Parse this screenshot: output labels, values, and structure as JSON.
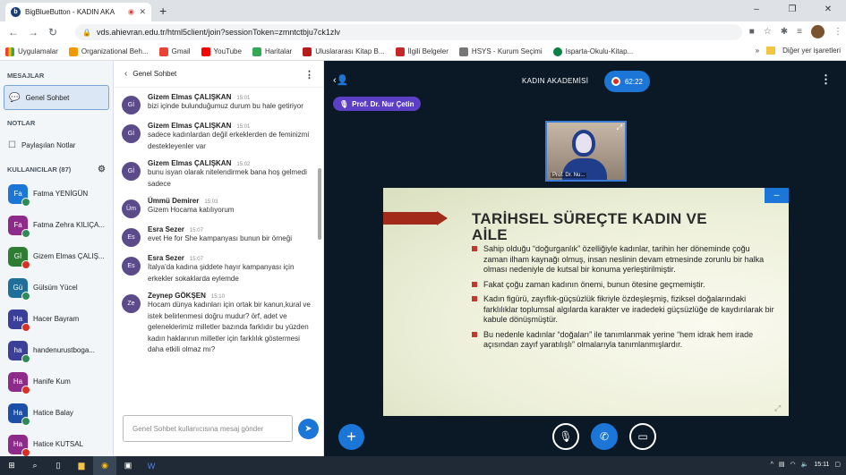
{
  "browser": {
    "tab_title": "BigBlueButton - KADIN AKA",
    "address": "vds.ahievran.edu.tr/html5client/join?sessionToken=zmntctbju7ck1zlv",
    "bookmarks": [
      "Uygulamalar",
      "Organizational Beh...",
      "Gmail",
      "YouTube",
      "Haritalar",
      "Uluslararası Kitap B...",
      "İlgili Belgeler",
      "HSYS - Kurum Seçimi",
      "Isparta-Okulu-Kitap..."
    ],
    "other_bookmarks": "Diğer yer işaretleri"
  },
  "sidebar": {
    "messages_header": "MESAJLAR",
    "public_chat": "Genel Sohbet",
    "notes_header": "NOTLAR",
    "shared_notes": "Paylaşılan Notlar",
    "users_header": "KULLANICILAR (87)",
    "users": [
      {
        "initials": "Fa",
        "name": "Fatma YENİGÜN",
        "color": "#1b76d8",
        "mic": "on"
      },
      {
        "initials": "Fa",
        "name": "Fatma Zehra KILIÇA...",
        "color": "#8e2a8a",
        "mic": "on"
      },
      {
        "initials": "Gİ",
        "name": "Gizem Elmas ÇALIŞ...",
        "color": "#2e7d32",
        "mic": "off"
      },
      {
        "initials": "Gü",
        "name": "Gülsüm Yücel",
        "color": "#1e6f9a",
        "mic": "on"
      },
      {
        "initials": "Ha",
        "name": "Hacer Bayram",
        "color": "#3a3f9a",
        "mic": "off"
      },
      {
        "initials": "ha",
        "name": "handenurustboga...",
        "color": "#3a3f9a",
        "mic": "on"
      },
      {
        "initials": "Ha",
        "name": "Hanife Kum",
        "color": "#8e2a8a",
        "mic": "off"
      },
      {
        "initials": "Ha",
        "name": "Hatice Balay",
        "color": "#1e4fa8",
        "mic": "on"
      },
      {
        "initials": "Ha",
        "name": "Hatice KUTSAL",
        "color": "#8e2a8a",
        "mic": "off"
      }
    ]
  },
  "chat": {
    "header": "Genel Sohbet",
    "messages": [
      {
        "initials": "Gİ",
        "name": "Gizem Elmas ÇALIŞKAN",
        "time": "15:01",
        "text": "bizi içinde bulunduğumuz durum bu hale getiriyor"
      },
      {
        "initials": "Gİ",
        "name": "Gizem Elmas ÇALIŞKAN",
        "time": "15:01",
        "text": "sadece kadınlardan değil erkeklerden de feminizmi destekleyenler var"
      },
      {
        "initials": "Gİ",
        "name": "Gizem Elmas ÇALIŞKAN",
        "time": "15:02",
        "text": "bunu isyan olarak nitelendirmek bana hoş gelmedi sadece"
      },
      {
        "initials": "Üm",
        "name": "Ümmü Demirer",
        "time": "15:03",
        "text": "Gizem Hocama katılıyorum"
      },
      {
        "initials": "Es",
        "name": "Esra Sezer",
        "time": "15:07",
        "text": "evet He for She kampanyası bunun bir örneği"
      },
      {
        "initials": "Es",
        "name": "Esra Sezer",
        "time": "15:07",
        "text": "İtalya'da kadına şiddete hayır kampanyası için erkekler sokaklarda eylemde"
      },
      {
        "initials": "Ze",
        "name": "Zeynep GÖKŞEN",
        "time": "15:10",
        "text": "Hocam dünya kadınları için ortak bir kanun,kural ve istek belirlenmesi doğru mudur? örf, adet ve geleneklerimiz milletler bazında farklıdır bu yüzden kadın haklarının milletler için farklılık göstermesi daha etkili olmaz mı?"
      }
    ],
    "input_placeholder": "Genel Sohbet kullanıcısına mesaj gönder"
  },
  "meeting": {
    "title": "KADIN AKADEMİSİ",
    "timer": "62:22",
    "talker": "Prof. Dr. Nur Çetin",
    "camera_label": "Prof. Dr. Nu..."
  },
  "slide": {
    "title": "TARİHSEL SÜREÇTE KADIN VE AİLE",
    "bullets": [
      "Sahip olduğu “doğurganlık” özelliğiyle kadınlar, tarihin her döneminde çoğu zaman ilham kaynağı olmuş, insan neslinin devam etmesinde zorunlu bir halka olması nedeniyle de kutsal bir konuma yerleştirilmiştir.",
      "Fakat çoğu zaman kadının önemi, bunun ötesine geçmemiştir.",
      "Kadın figürü, zayıflık-güçsüzlük fikriyle özdeşleşmiş, fiziksel doğalarındaki farklılıklar toplumsal algılarda karakter ve iradedeki güçsüzlüğe de kaydırılarak bir kabule dönüşmüştür.",
      "Bu nedenle kadınlar “doğaları” ile tanımlanmak yerine “hem idrak hem irade açısından zayıf yaratılışlı” olmalarıyla tanımlanmışlardır."
    ]
  },
  "taskbar": {
    "time": "15:11"
  },
  "colors": {
    "accent": "#1b76d8",
    "dark_bg": "#0b1825",
    "talker": "#5b3fc4",
    "slide_arrow": "#a22a1b"
  }
}
